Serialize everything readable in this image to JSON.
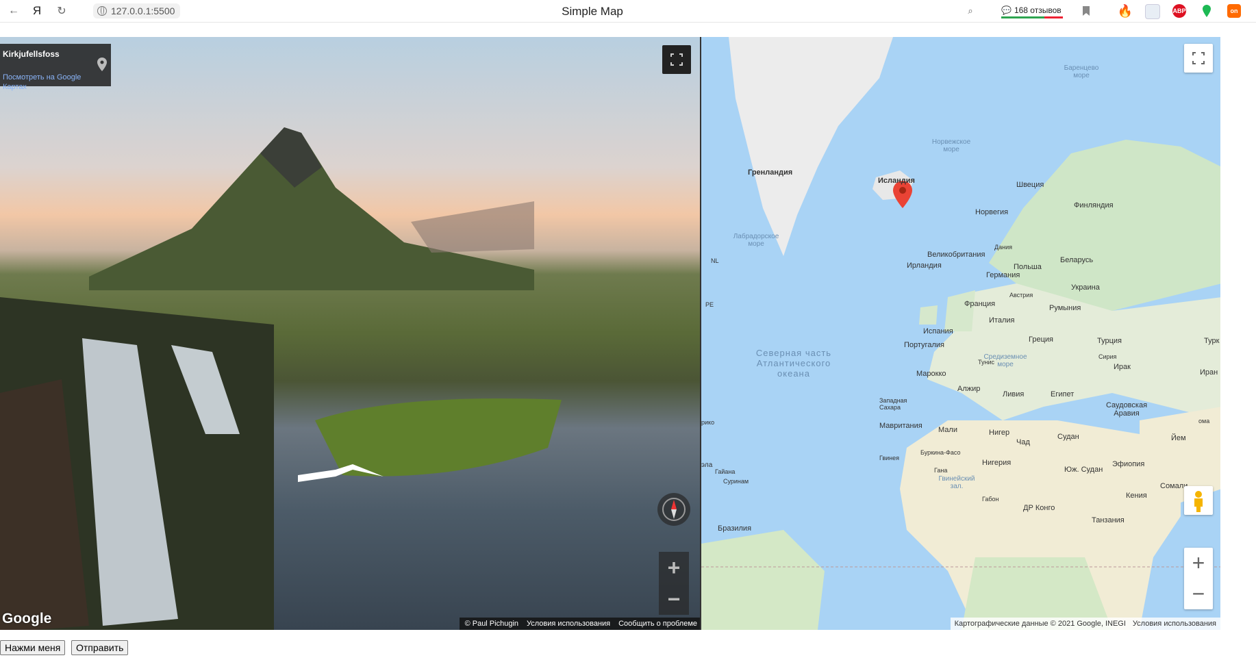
{
  "browser": {
    "back_icon": "back-arrow-icon",
    "yandex_label": "Я",
    "reload_icon": "reload-icon",
    "url": "127.0.0.1:5500",
    "tab_title": "Simple Map",
    "reviews_count": "168 отзывов"
  },
  "streetview": {
    "place_name": "Kirkjufellsfoss",
    "map_link": "Посмотреть на Google Картах",
    "logo": "Google",
    "footer": {
      "author": "© Paul Pichugin",
      "terms": "Условия использования",
      "report": "Сообщить о проблеме"
    },
    "zoom_in": "+",
    "zoom_out": "−"
  },
  "map": {
    "labels": {
      "greenland": "Гренландия",
      "iceland": "Исландия",
      "sweden": "Швеция",
      "finland": "Финляндия",
      "norway": "Норвегия",
      "denmark": "Дания",
      "uk": "Великобритания",
      "ireland": "Ирландия",
      "poland": "Польша",
      "belarus": "Беларусь",
      "germany": "Германия",
      "ukraine": "Украина",
      "austria": "Австрия",
      "france": "Франция",
      "romania": "Румыния",
      "italy": "Италия",
      "spain": "Испания",
      "portugal": "Португалия",
      "greece": "Греция",
      "turkey": "Турция",
      "turk_edge": "Турк",
      "tunisia": "Тунис",
      "syria": "Сирия",
      "iraq": "Ирак",
      "iran": "Иран",
      "morocco": "Марокко",
      "algeria": "Алжир",
      "libya": "Ливия",
      "egypt": "Египет",
      "saudi": "Саудовская Аравия",
      "western_sahara": "Западная Сахара",
      "mauritania": "Мавритания",
      "mali": "Мали",
      "niger": "Нигер",
      "chad": "Чад",
      "sudan": "Судан",
      "yemen": "Йем",
      "oman": "ома",
      "guinea": "Гвинея",
      "burkina": "Буркина-Фасо",
      "nigeria": "Нигерия",
      "south_sudan": "Юж. Судан",
      "ethiopia": "Эфиопия",
      "somalia": "Сомали",
      "ghana": "Гана",
      "kenya": "Кения",
      "gabon": "Габон",
      "drc": "ДР Конго",
      "tanzania": "Танзания",
      "guyana": "Гайана",
      "suriname": "Суринам",
      "brazil": "Бразилия",
      "ela": "эла",
      "rico": "рико",
      "nl": "NL",
      "pe": "PE"
    },
    "seas": {
      "barents": "Баренцево море",
      "norwegian": "Норвежское море",
      "labrador": "Лабрадорское море",
      "mediterranean": "Средиземное море",
      "guinea_gulf": "Гвинейский зал.",
      "atlantic": "Северная часть Атлантического океана"
    },
    "zoom_in": "+",
    "zoom_out": "−",
    "footer": {
      "data": "Картографические данные © 2021 Google, INEGI",
      "terms": "Условия использования"
    }
  },
  "buttons": {
    "click_me": "Нажми меня",
    "send": "Отправить"
  }
}
